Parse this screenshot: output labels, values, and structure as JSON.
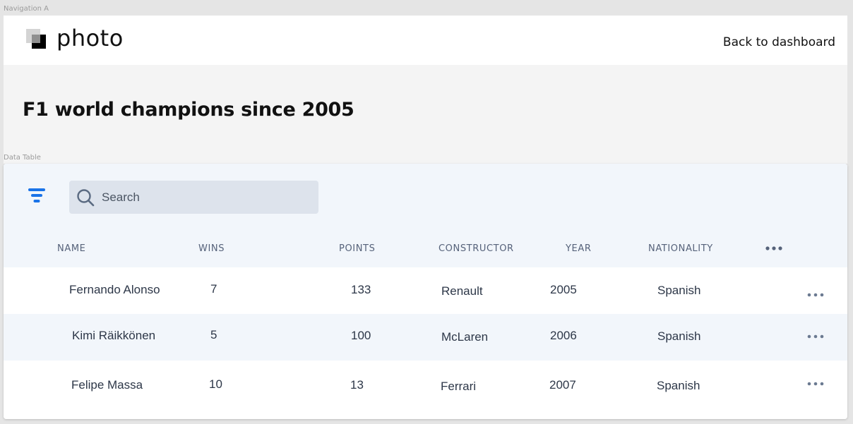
{
  "frames": {
    "navigation_label": "Navigation A",
    "table_label": "Data Table"
  },
  "nav": {
    "logo_text": "photo",
    "back_link": "Back to dashboard"
  },
  "page": {
    "title": "F1 world champions since 2005"
  },
  "table": {
    "search_placeholder": "Search",
    "filter_icon": "filter-icon",
    "columns": [
      "NAME",
      "WINS",
      "POINTS",
      "CONSTRUCTOR",
      "YEAR",
      "NATIONALITY"
    ],
    "rows": [
      {
        "name": "Fernando Alonso",
        "wins": "7",
        "points": "133",
        "constructor": "Renault",
        "year": "2005",
        "nationality": "Spanish"
      },
      {
        "name": "Kimi Räikkönen",
        "wins": "5",
        "points": "100",
        "constructor": "McLaren",
        "year": "2006",
        "nationality": "Spanish"
      },
      {
        "name": "Felipe Massa",
        "wins": "10",
        "points": "13",
        "constructor": "Ferrari",
        "year": "2007",
        "nationality": "Spanish"
      }
    ]
  },
  "colors": {
    "accent": "#1a73e8",
    "toolbar_bg": "#f2f6fb",
    "search_bg": "#dde3ec",
    "header_text": "#56627a"
  }
}
